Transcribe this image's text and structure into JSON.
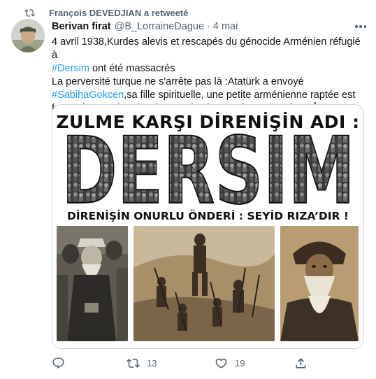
{
  "retweet": {
    "icon": "retweet-icon",
    "label": "François DEVEDJIAN a retweeté"
  },
  "tweet": {
    "author_name": "Berivan firat",
    "handle": "@B_LorraineDague",
    "separator": "·",
    "time": "4 mai",
    "line1": "4 avril 1938,Kurdes alevis et rescapés du génocide Arménien réfugié à",
    "hashtag_dersim": "#Dersim",
    "line2_rest": " ont été massacrés",
    "line3_start": "La perversité turque ne s'arrête pas là :Atatürk a envoyé ",
    "hashtag_sabiha": "#SabihaGokcen",
    "line3_end": ",sa fille spirituelle, une petite arménienne raptée est formatée pour bombarder Dersim, les Kurdes et les siens",
    "exclamation_emoji": "❗"
  },
  "media": {
    "poster_title": "ZULME KARŞI DİRENİŞİN ADI :",
    "big_word": "DERSIM",
    "sub_title": "DİRENİŞİN ONURLU ÖNDERİ : SEYİD RIZA’DIR !"
  },
  "actions": {
    "reply": {
      "icon": "reply-icon",
      "count": ""
    },
    "retweet": {
      "icon": "retweet-icon",
      "count": "13"
    },
    "like": {
      "icon": "heart-icon",
      "count": "19"
    },
    "share": {
      "icon": "share-icon",
      "count": ""
    }
  },
  "colors": {
    "accent": "#1d9bf0",
    "muted": "#536471",
    "text": "#0f1419",
    "alert_red": "#e0245e"
  }
}
